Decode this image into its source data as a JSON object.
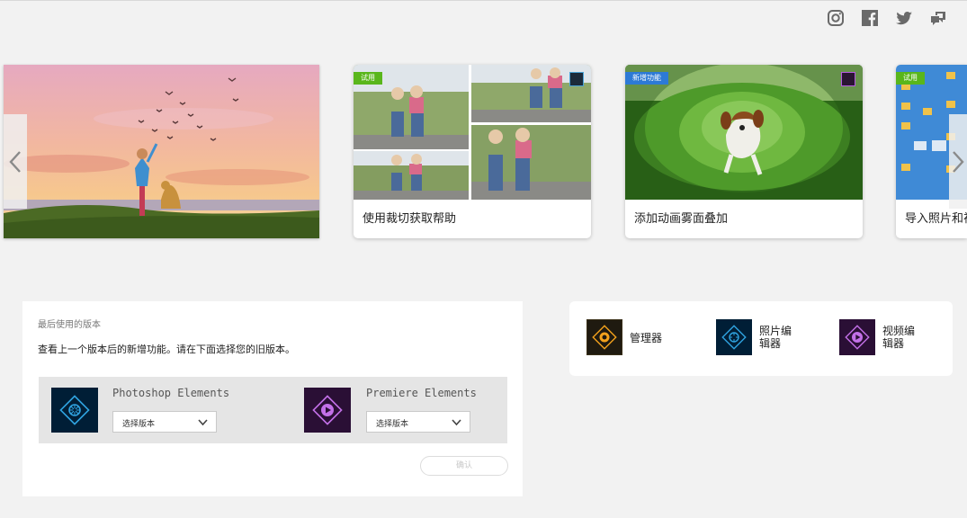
{
  "social": {
    "icons": [
      "instagram-icon",
      "facebook-icon",
      "twitter-icon",
      "feedback-icon"
    ]
  },
  "carousel": {
    "cards": [
      {
        "title": "使用裁切获取帮助",
        "badge": "试用"
      },
      {
        "title": "添加动画雾面叠加",
        "badge": "新增功能"
      },
      {
        "title": "导入照片和视",
        "badge": "试用"
      }
    ]
  },
  "last_used": {
    "heading": "最后使用的版本",
    "description": "查看上一个版本后的新增功能。请在下面选择您的旧版本。",
    "products": [
      {
        "name": "Photoshop Elements",
        "select_value": "选择版本"
      },
      {
        "name": "Premiere Elements",
        "select_value": "选择版本"
      }
    ],
    "confirm_label": "确认"
  },
  "apps": [
    {
      "label_line1": "管理器",
      "label_line2": ""
    },
    {
      "label_line1": "照片编",
      "label_line2": "辑器"
    },
    {
      "label_line1": "视频编",
      "label_line2": "辑器"
    }
  ],
  "colors": {
    "background": "#f2f2f2",
    "badge_green": "#59b61b",
    "badge_blue": "#2d7ad6",
    "photoshop_accent": "#2fa3e0",
    "premiere_accent": "#c370e8",
    "organizer_accent": "#f4a21c"
  }
}
